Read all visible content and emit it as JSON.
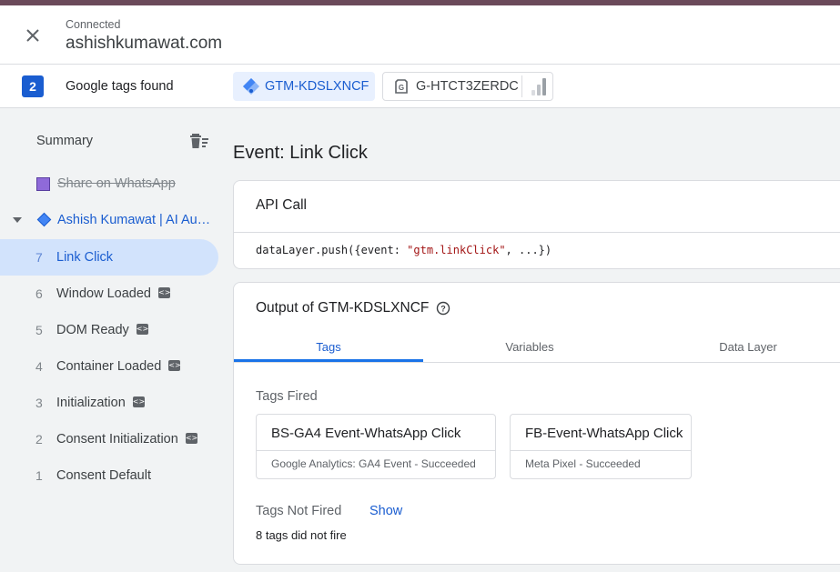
{
  "header": {
    "status": "Connected",
    "domain": "ashishkumawat.com"
  },
  "tags_bar": {
    "count": "2",
    "found_label": "Google tags found",
    "chips": [
      {
        "label": "GTM-KDSLXNCF",
        "icon": "gtm-diamond-icon",
        "selected": true
      },
      {
        "label": "G-HTCT3ZERDC",
        "icon": "google-tag-icon",
        "extra_icon": "analytics-bars-icon",
        "selected": false
      }
    ]
  },
  "sidebar": {
    "summary_label": "Summary",
    "share_item": "Share on WhatsApp",
    "container_name": "Ashish Kumawat | AI Au…",
    "items": [
      {
        "num": "7",
        "label": "Link Click",
        "active": true,
        "code_icon": false
      },
      {
        "num": "6",
        "label": "Window Loaded",
        "active": false,
        "code_icon": true
      },
      {
        "num": "5",
        "label": "DOM Ready",
        "active": false,
        "code_icon": true
      },
      {
        "num": "4",
        "label": "Container Loaded",
        "active": false,
        "code_icon": true
      },
      {
        "num": "3",
        "label": "Initialization",
        "active": false,
        "code_icon": true
      },
      {
        "num": "2",
        "label": "Consent Initialization",
        "active": false,
        "code_icon": true
      },
      {
        "num": "1",
        "label": "Consent Default",
        "active": false,
        "code_icon": false
      }
    ]
  },
  "main": {
    "event_title": "Event: Link Click",
    "api_call": {
      "title": "API Call",
      "code_prefix": "dataLayer.push({event: ",
      "code_string": "\"gtm.linkClick\"",
      "code_suffix": ", ...})"
    },
    "output": {
      "title": "Output of GTM-KDSLXNCF",
      "tabs": [
        "Tags",
        "Variables",
        "Data Layer"
      ],
      "active_tab": "Tags",
      "tags_fired_label": "Tags Fired",
      "tags_fired": [
        {
          "name": "BS-GA4 Event-WhatsApp Click",
          "status": "Google Analytics: GA4 Event - Succeeded"
        },
        {
          "name": "FB-Event-WhatsApp Click",
          "status": "Meta Pixel - Succeeded"
        }
      ],
      "tags_not_fired_label": "Tags Not Fired",
      "show_label": "Show",
      "not_fired_summary": "8 tags did not fire"
    }
  },
  "colors": {
    "accent": "#1a5dd0",
    "active_bg": "#d2e3fc",
    "top_strip": "#6b4a5a"
  }
}
